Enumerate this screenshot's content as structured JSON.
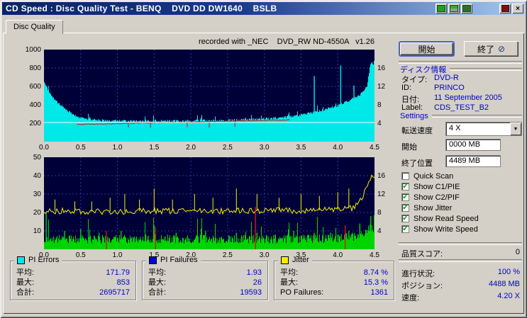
{
  "window": {
    "title": "CD Speed : Disc Quality Test - BENQ    DVD DD DW1640    BSLB"
  },
  "icons": {
    "close": "×",
    "dropdown": "▼",
    "checkmark": "✓",
    "exit": "⊘"
  },
  "tab": {
    "label": "Disc Quality"
  },
  "chart_header": "recorded with _NEC    DVD_RW ND-4550A   v1.26",
  "chart_style": {
    "bg": "#000038",
    "grid": "#3434a6"
  },
  "legends": [
    {
      "title": "PI Errors",
      "color": "#00e8e8",
      "rows": [
        {
          "label": "平均:",
          "value": "171.79"
        },
        {
          "label": "最大:",
          "value": "853"
        },
        {
          "label": "合計:",
          "value": "2695717"
        }
      ]
    },
    {
      "title": "PI Failures",
      "color": "#0000d8",
      "rows": [
        {
          "label": "平均:",
          "value": "1.93"
        },
        {
          "label": "最大:",
          "value": "26"
        },
        {
          "label": "合計:",
          "value": "19593"
        }
      ]
    },
    {
      "title": "Jitter",
      "color": "#f0f000",
      "rows": [
        {
          "label": "平均:",
          "value": "8.74 %"
        },
        {
          "label": "最大:",
          "value": "15.3 %"
        },
        {
          "label": "PO Failures:",
          "value": "1361"
        }
      ]
    }
  ],
  "right_panel": {
    "start_button": "開始",
    "exit_button": "終了",
    "disc_info": {
      "header": "ディスク情報",
      "rows": [
        {
          "label": "タイプ:",
          "value": "DVD-R"
        },
        {
          "label": "ID:",
          "value": "PRINCO"
        },
        {
          "label": "日付:",
          "value": "11 September 2005"
        },
        {
          "label": "Label:",
          "value": "CDS_TEST_B2"
        }
      ]
    },
    "settings": {
      "header": "Settings",
      "speed_label": "転送速度",
      "speed_value": "4 X",
      "start_label": "開始",
      "start_value": "0000 MB",
      "end_label": "終了位置",
      "end_value": "4489 MB"
    },
    "checkboxes": [
      {
        "label": "Quick Scan",
        "checked": false
      },
      {
        "label": "Show C1/PIE",
        "checked": true
      },
      {
        "label": "Show C2/PIF",
        "checked": true
      },
      {
        "label": "Show Jitter",
        "checked": true
      },
      {
        "label": "Show Read Speed",
        "checked": true
      },
      {
        "label": "Show Write Speed",
        "checked": true
      }
    ],
    "quality": {
      "label": "品質スコア:",
      "value": "0"
    },
    "status": [
      {
        "label": "進行状況:",
        "value": "100 %"
      },
      {
        "label": "ポジション:",
        "value": "4488 MB"
      },
      {
        "label": "速度:",
        "value": "4.20 X"
      }
    ]
  },
  "chart_data": [
    {
      "id": "top",
      "type": "area",
      "title": "PI Errors vs disc position (GB)",
      "x_range": [
        0,
        4.5
      ],
      "y_left": {
        "range": [
          0,
          1000
        ],
        "ticks": [
          [
            1000,
            "1000"
          ],
          [
            800,
            "800"
          ],
          [
            600,
            "600"
          ],
          [
            400,
            "400"
          ],
          [
            200,
            "200"
          ]
        ]
      },
      "y_right": {
        "range": [
          0,
          20
        ],
        "ticks": [
          [
            16,
            "16"
          ],
          [
            12,
            "12"
          ],
          [
            8,
            "8"
          ],
          [
            4,
            "4"
          ]
        ]
      },
      "x_ticks": [
        [
          0,
          "0.0"
        ],
        [
          0.5,
          "0.5"
        ],
        [
          1,
          "1.0"
        ],
        [
          1.5,
          "1.5"
        ],
        [
          2,
          "2.0"
        ],
        [
          2.5,
          "2.5"
        ],
        [
          3,
          "3.0"
        ],
        [
          3.5,
          "3.5"
        ],
        [
          4,
          "4.0"
        ],
        [
          4.5,
          "4.5"
        ]
      ],
      "grid_x": [
        0.5,
        1,
        1.5,
        2,
        2.5,
        3,
        3.5,
        4
      ],
      "grid_y": [
        200,
        400,
        600,
        800
      ],
      "series": [
        {
          "name": "pi-errors-area",
          "color": "#00e8e8",
          "render": "columns",
          "noise": 26,
          "points": [
            [
              0,
              650
            ],
            [
              0.06,
              540
            ],
            [
              0.12,
              470
            ],
            [
              0.2,
              400
            ],
            [
              0.3,
              335
            ],
            [
              0.4,
              280
            ],
            [
              0.5,
              245
            ],
            [
              0.7,
              222
            ],
            [
              0.9,
              215
            ],
            [
              1.2,
              212
            ],
            [
              1.5,
              214
            ],
            [
              1.8,
              213
            ],
            [
              2.1,
              216
            ],
            [
              2.4,
              218
            ],
            [
              2.7,
              224
            ],
            [
              3,
              235
            ],
            [
              3.2,
              246
            ],
            [
              3.4,
              262
            ],
            [
              3.6,
              292
            ],
            [
              3.8,
              330
            ],
            [
              4,
              378
            ],
            [
              4.15,
              430
            ],
            [
              4.3,
              495
            ],
            [
              4.4,
              590
            ],
            [
              4.45,
              853
            ],
            [
              4.5,
              820
            ]
          ],
          "spikes": [
            [
              3.68,
              712
            ],
            [
              4.04,
              828
            ],
            [
              4.22,
              610
            ]
          ]
        },
        {
          "name": "read-speed-line",
          "color": "#c81616",
          "render": "noisyline",
          "noise": 4,
          "points": [
            [
              0.45,
              188
            ],
            [
              0.8,
              193
            ],
            [
              1.2,
              199
            ],
            [
              1.6,
              206
            ],
            [
              2,
              213
            ],
            [
              2.4,
              221
            ],
            [
              2.8,
              228
            ],
            [
              3.1,
              233
            ],
            [
              3.35,
              236
            ]
          ],
          "spikes": [
            [
              1.15,
              155
            ],
            [
              1.45,
              152
            ],
            [
              1.95,
              157
            ],
            [
              2.25,
              154
            ],
            [
              2.6,
              160
            ]
          ]
        },
        {
          "name": "write-speed-line",
          "color": "#ffffff",
          "render": "line",
          "noise": 0,
          "points": [
            [
              0,
              208
            ],
            [
              4.5,
              208
            ]
          ],
          "spikes": []
        }
      ]
    },
    {
      "id": "bottom",
      "type": "area",
      "title": "PI Failures / Jitter vs disc position (GB)",
      "x_range": [
        0,
        4.5
      ],
      "y_left": {
        "range": [
          0,
          50
        ],
        "ticks": [
          [
            50,
            "50"
          ],
          [
            40,
            "40"
          ],
          [
            30,
            "30"
          ],
          [
            20,
            "20"
          ],
          [
            10,
            "10"
          ]
        ]
      },
      "y_right": {
        "range": [
          0,
          20
        ],
        "ticks": [
          [
            16,
            "16"
          ],
          [
            12,
            "12"
          ],
          [
            8,
            "8"
          ],
          [
            4,
            "4"
          ]
        ]
      },
      "x_ticks": [
        [
          0,
          "0.0"
        ],
        [
          0.5,
          "0.5"
        ],
        [
          1,
          "1.0"
        ],
        [
          1.5,
          "1.5"
        ],
        [
          2,
          "2.0"
        ],
        [
          2.5,
          "2.5"
        ],
        [
          3,
          "3.0"
        ],
        [
          3.5,
          "3.5"
        ],
        [
          4,
          "4.0"
        ],
        [
          4.5,
          "4.5"
        ]
      ],
      "grid_x": [
        0.5,
        1,
        1.5,
        2,
        2.5,
        3,
        3.5,
        4
      ],
      "grid_y": [
        10,
        20,
        30,
        40
      ],
      "series": [
        {
          "name": "pi-failures-bars",
          "color": "#00d400",
          "render": "columns",
          "noise": 5,
          "points": [
            [
              0,
              3
            ],
            [
              0.5,
              3
            ],
            [
              1,
              3
            ],
            [
              1.5,
              3.2
            ],
            [
              2,
              3
            ],
            [
              2.5,
              3
            ],
            [
              3,
              3
            ],
            [
              3.5,
              3
            ],
            [
              4,
              3.5
            ],
            [
              4.3,
              5
            ],
            [
              4.45,
              9
            ],
            [
              4.5,
              8
            ]
          ],
          "spikes": [
            [
              0.03,
              20
            ],
            [
              0.28,
              10
            ],
            [
              0.5,
              11
            ],
            [
              0.75,
              9
            ],
            [
              1.05,
              10
            ],
            [
              1.5,
              13
            ],
            [
              1.8,
              9
            ],
            [
              2.2,
              10
            ],
            [
              2.62,
              9
            ],
            [
              2.9,
              9
            ],
            [
              3.15,
              8
            ],
            [
              3.4,
              10
            ],
            [
              3.68,
              9
            ],
            [
              3.9,
              9
            ],
            [
              4.15,
              10
            ],
            [
              4.3,
              14
            ],
            [
              4.45,
              18
            ]
          ]
        },
        {
          "name": "jitter-line",
          "color": "#f0f000",
          "render": "noisyline",
          "noise": 1.6,
          "points": [
            [
              0,
              21
            ],
            [
              0.5,
              20.5
            ],
            [
              1,
              20.5
            ],
            [
              1.5,
              20.8
            ],
            [
              2,
              21
            ],
            [
              2.5,
              20.8
            ],
            [
              3,
              21
            ],
            [
              3.5,
              21
            ],
            [
              4,
              21.5
            ],
            [
              4.2,
              22.5
            ],
            [
              4.3,
              26
            ],
            [
              4.4,
              34
            ],
            [
              4.46,
              40
            ],
            [
              4.5,
              38
            ]
          ],
          "spikes": [
            [
              0.15,
              27
            ],
            [
              0.42,
              26
            ],
            [
              0.65,
              26
            ],
            [
              0.9,
              28
            ],
            [
              1.1,
              30
            ],
            [
              1.3,
              27
            ],
            [
              1.5,
              33
            ],
            [
              1.75,
              27
            ],
            [
              2.05,
              30
            ],
            [
              2.3,
              28
            ],
            [
              2.62,
              33
            ],
            [
              2.9,
              30
            ],
            [
              3.2,
              28
            ],
            [
              3.5,
              30
            ],
            [
              3.75,
              29
            ],
            [
              4,
              31
            ],
            [
              4.15,
              33
            ]
          ]
        },
        {
          "name": "po-failures-spikes",
          "color": "#d41414",
          "render": "vspikes",
          "spikes": [
            [
              0.85,
              10
            ],
            [
              1.52,
              12
            ],
            [
              2.88,
              23
            ],
            [
              4.1,
              13
            ]
          ]
        }
      ]
    }
  ]
}
